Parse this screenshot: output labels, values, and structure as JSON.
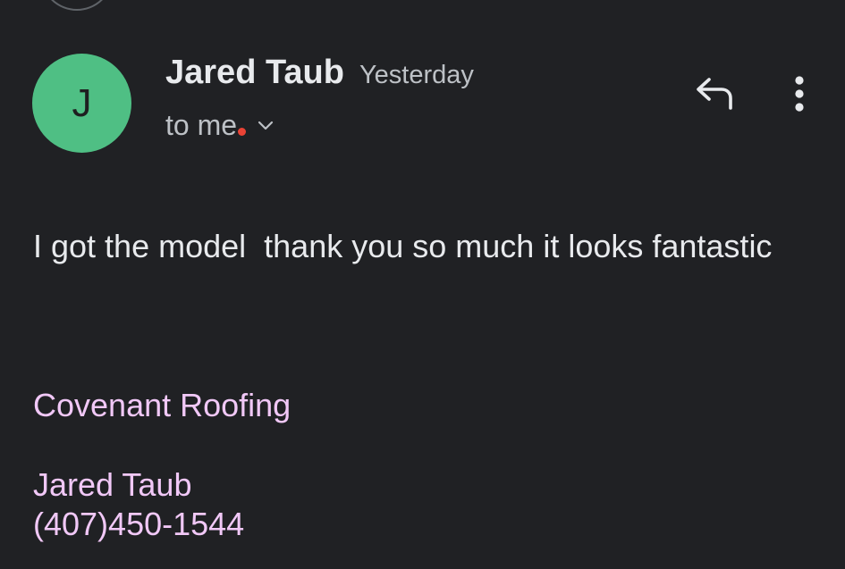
{
  "message": {
    "sender": {
      "initial": "J",
      "name": "Jared Taub",
      "avatar_color": "#4fbf84"
    },
    "timestamp": "Yesterday",
    "recipient": "to me",
    "unread_indicator_color": "#ea4335",
    "actions": {
      "reply_icon": "reply-icon",
      "more_icon": "more-vert-icon"
    },
    "body": "I got the model  thank you so much it looks fantastic",
    "signature": {
      "company": "Covenant Roofing",
      "name": "Jared Taub",
      "phone": "(407)450-1544",
      "color": "#f1c8f7"
    }
  }
}
